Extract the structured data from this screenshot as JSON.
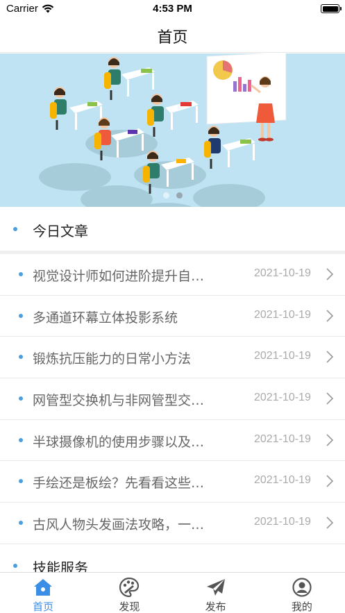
{
  "status_bar": {
    "carrier": "Carrier",
    "time": "4:53 PM",
    "battery_level": 1.0
  },
  "nav": {
    "title": "首页"
  },
  "banner": {
    "slide_count": 2,
    "active_slide": 1
  },
  "sections": [
    {
      "label": "今日文章"
    },
    {
      "label": "技能服务"
    }
  ],
  "articles": [
    {
      "title": "视觉设计师如何进阶提升自…",
      "date": "2021-10-19"
    },
    {
      "title": "多通道环幕立体投影系统",
      "date": "2021-10-19"
    },
    {
      "title": "锻炼抗压能力的日常小方法",
      "date": "2021-10-19"
    },
    {
      "title": "网管型交换机与非网管型交…",
      "date": "2021-10-19"
    },
    {
      "title": "半球摄像机的使用步骤以及…",
      "date": "2021-10-19"
    },
    {
      "title": "手绘还是板绘？先看看这些…",
      "date": "2021-10-19"
    },
    {
      "title": "古风人物头发画法攻略，一…",
      "date": "2021-10-19"
    }
  ],
  "tabs": [
    {
      "label": "首页",
      "icon": "home-icon",
      "active": true
    },
    {
      "label": "发现",
      "icon": "palette-icon",
      "active": false
    },
    {
      "label": "发布",
      "icon": "paper-plane-icon",
      "active": false
    },
    {
      "label": "我的",
      "icon": "user-icon",
      "active": false
    }
  ],
  "colors": {
    "accent": "#3a8ee6",
    "bullet": "#4a9fe0",
    "banner_bg": "#bfe3f3"
  }
}
